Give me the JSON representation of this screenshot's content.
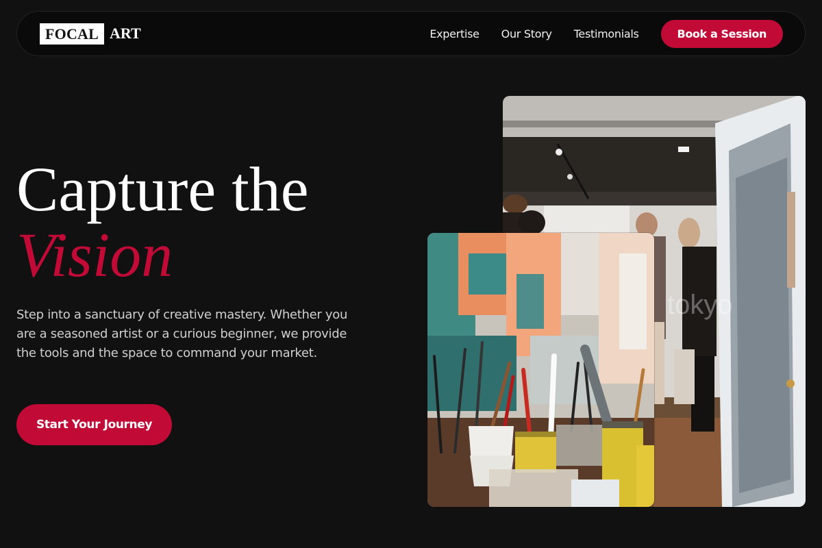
{
  "nav": {
    "logo_box": "FOCAL",
    "logo_rest": "ART",
    "links": [
      "Expertise",
      "Our Story",
      "Testimonials"
    ],
    "cta": "Book a Session"
  },
  "hero": {
    "title_line1": "Capture the",
    "title_accent": "Vision",
    "description": "Step into a sanctuary of creative mastery. Whether you are a seasoned artist or a curious beginner, we provide the tools and the space to command your market.",
    "cta": "Start Your Journey"
  },
  "images": {
    "gallery_sign": "tokyo"
  },
  "colors": {
    "background": "#111112",
    "accent": "#c20a37",
    "nav_background": "#0a0a0b"
  }
}
